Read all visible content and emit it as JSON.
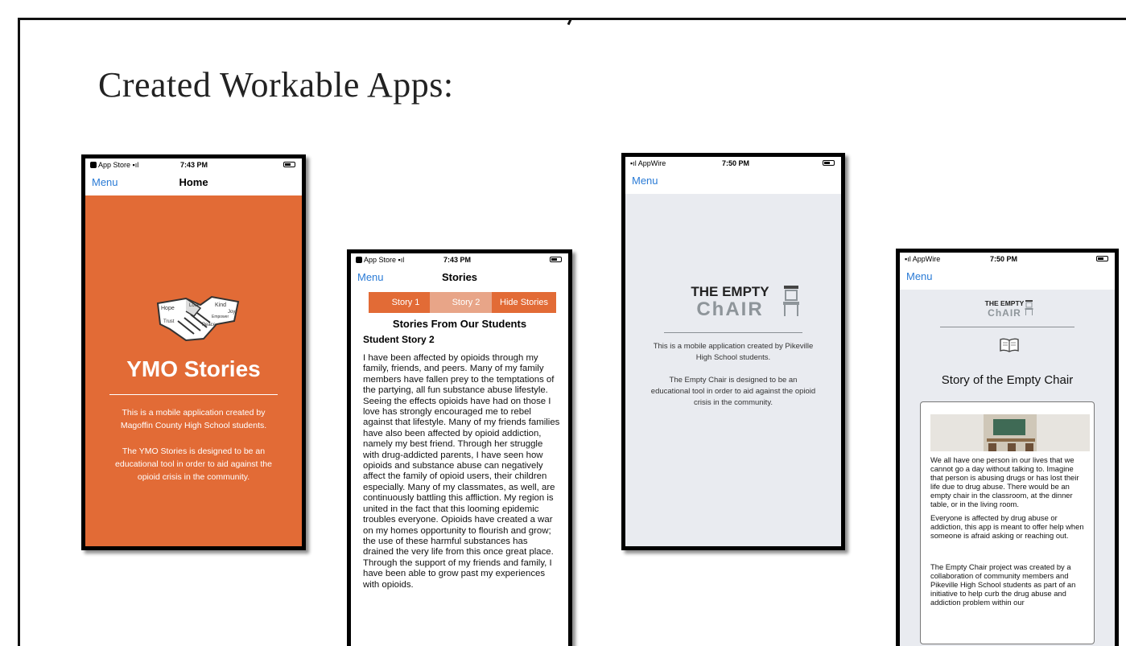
{
  "slide": {
    "title": "Created Workable Apps:"
  },
  "phone1": {
    "status": {
      "carrier": "App Store",
      "time": "7:43 PM"
    },
    "nav": {
      "menu": "Menu",
      "title": "Home"
    },
    "app_title": "YMO Stories",
    "desc1": "This is a mobile application created by Magoffin County High School students.",
    "desc2": "The YMO Stories is designed to be an educational tool in order to aid against the opioid crisis in the community.",
    "logo_words": [
      "Hope",
      "Love",
      "Kind",
      "Joy",
      "Trust",
      "Empower",
      "Peace"
    ],
    "accent": "#e26b36"
  },
  "phone2": {
    "status": {
      "carrier": "App Store",
      "time": "7:43 PM"
    },
    "nav": {
      "menu": "Menu",
      "title": "Stories"
    },
    "tabs": [
      "Story 1",
      "Story 2",
      "Hide Stories"
    ],
    "active_tab": "Story 2",
    "heading": "Stories From Our Students",
    "subheading": "Student Story 2",
    "body": "I have been affected by opioids through my family, friends, and peers. Many of my family members have fallen prey to the temptations of the partying, all fun substance abuse lifestyle. Seeing the effects opioids have had on those I love has strongly encouraged me to rebel against that lifestyle. Many of my friends families have also been affected by opioid addiction, namely my best friend. Through her struggle with drug-addicted parents, I have seen how opioids and substance abuse can negatively affect the family of opioid users, their children especially. Many of my classmates, as well, are continuously battling this affliction. My region is united in the fact that this looming epidemic troubles everyone. Opioids have created a war on my homes opportunity to flourish and grow; the use of these harmful substances has drained the very life from this once great place. Through the support of my friends and family, I have been able to grow past my experiences with opioids."
  },
  "phone3": {
    "status": {
      "carrier": "AppWire",
      "time": "7:50 PM"
    },
    "nav": {
      "menu": "Menu"
    },
    "logo_line1": "THE EMPTY",
    "logo_line2": "ChAIR",
    "desc1": "This is a mobile application created by Pikeville High School students.",
    "desc2": "The Empty Chair is designed to be an educational tool in order to aid against the opioid crisis in the community."
  },
  "phone4": {
    "status": {
      "carrier": "AppWire",
      "time": "7:50 PM"
    },
    "nav": {
      "menu": "Menu"
    },
    "logo_line1": "THE EMPTY",
    "logo_line2": "ChAIR",
    "section_title": "Story of the Empty Chair",
    "para1": "We all have one person in our lives that we cannot go a day without talking to. Imagine that person is abusing drugs or has lost their life due to drug abuse. There would be an empty chair in the classroom, at the dinner table, or in the living room.",
    "para2": "Everyone is affected by drug abuse or addiction, this app is meant to offer help when someone is afraid asking or reaching out.",
    "para3": "The Empty Chair project was created by a collaboration of community members and Pikeville High School students as part of an initiative to help curb the drug abuse and addiction problem within our"
  }
}
